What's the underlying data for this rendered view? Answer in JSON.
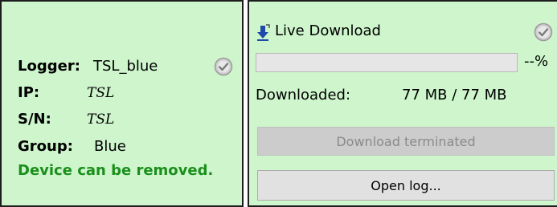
{
  "logger": {
    "logger_label": "Logger:",
    "logger_value": "TSL_blue",
    "ip_label": "IP:",
    "ip_value": "TSL",
    "sn_label": "S/N:",
    "sn_value": "TSL",
    "group_label": "Group:",
    "group_value": "Blue",
    "status_message": "Device can be removed.",
    "status_icon": "check-circle-icon"
  },
  "download": {
    "title": "Live Download",
    "title_icon": "download-arrow-icon",
    "status_icon": "check-circle-icon",
    "progress_percent": 0,
    "progress_text": "--%",
    "downloaded_label": "Downloaded:",
    "downloaded_value": "77 MB / 77 MB",
    "terminated_button_label": "Download terminated",
    "open_log_button_label": "Open log..."
  },
  "colors": {
    "panel_background": "#cef5cc",
    "status_green": "#1b8f1b"
  }
}
